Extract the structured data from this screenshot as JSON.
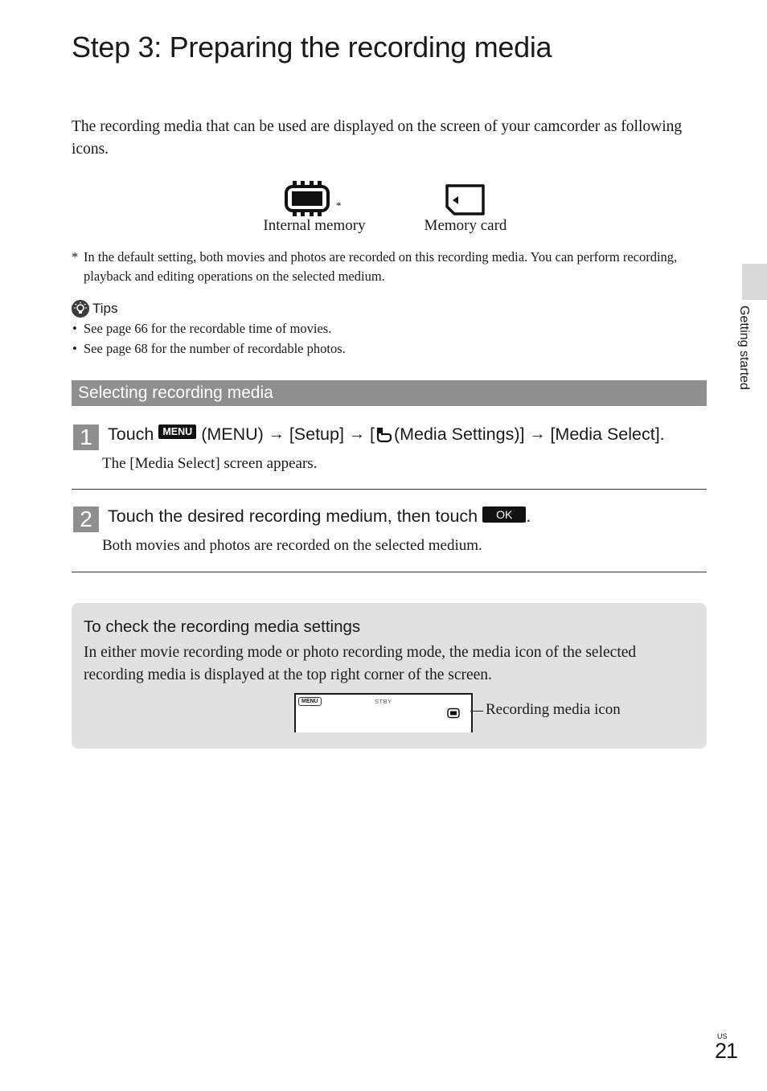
{
  "page": {
    "title": "Step 3: Preparing the recording media",
    "intro": "The recording media that can be used are displayed on the screen of your camcorder as following icons.",
    "media_icons": [
      {
        "icon": "internal-memory-icon",
        "label": "Internal memory",
        "marker": "*"
      },
      {
        "icon": "memory-card-icon",
        "label": "Memory card"
      }
    ],
    "footnote": {
      "marker": "*",
      "text": "In the default setting, both movies and photos are recorded on this recording media. You can perform recording, playback and editing operations on the selected medium."
    },
    "tips": {
      "icon": "lightbulb-icon",
      "heading": "Tips",
      "items": [
        "See page 66 for the recordable time of movies.",
        "See page 68 for the number of recordable photos."
      ]
    },
    "section": {
      "heading": "Selecting recording media"
    },
    "steps": [
      {
        "number": "1",
        "parts": {
          "touch": "Touch",
          "menu_button": "MENU",
          "menu_paren": "(MENU)",
          "arrow": "→",
          "setup": "[Setup]",
          "open_bracket": "[",
          "media_settings": "(Media Settings)]",
          "media_select": "[Media Select]."
        },
        "sub": "The [Media Select] screen appears."
      },
      {
        "number": "2",
        "parts": {
          "text": "Touch the desired recording medium, then touch",
          "ok_button": "OK",
          "period": "."
        },
        "sub": "Both movies and photos are recorded on the selected medium."
      }
    ],
    "check_box": {
      "title": "To check the recording media settings",
      "text": "In either movie recording mode or photo recording mode, the media icon of the selected recording media is displayed at the top right corner of the screen.",
      "lcd": {
        "menu_label": "MENU",
        "status": "STBY"
      },
      "callout": "Recording media icon"
    },
    "side_tab": "Getting started",
    "page_region": "US",
    "page_number": "21"
  }
}
